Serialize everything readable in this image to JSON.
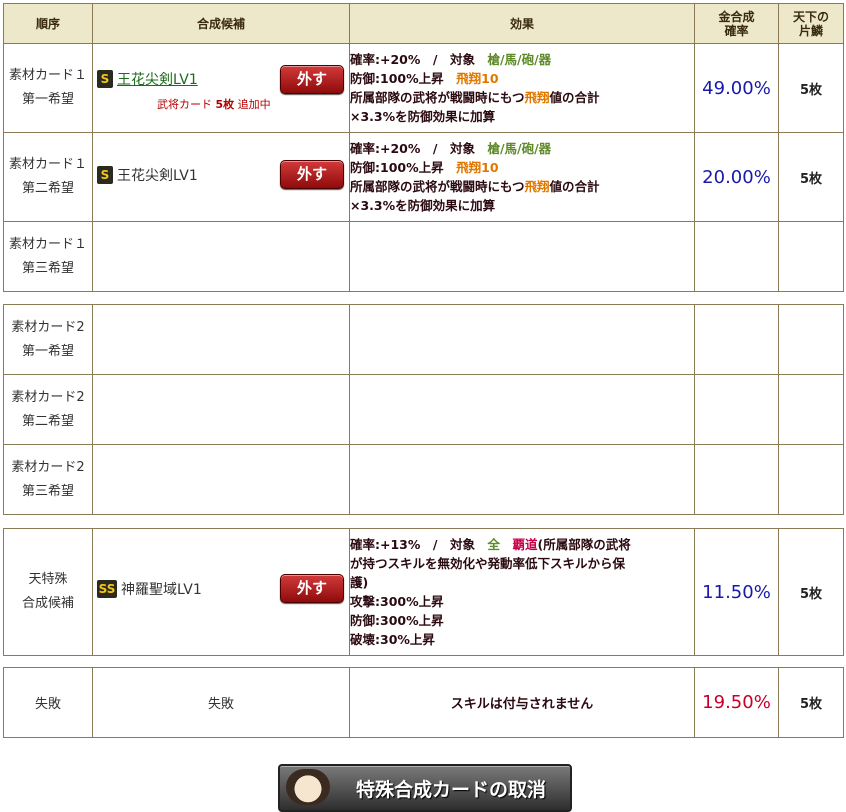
{
  "headers": {
    "order": "順序",
    "candidate": "合成候補",
    "effect": "効果",
    "gold_prob_line1": "金合成",
    "gold_prob_line2": "確率",
    "scale_line1": "天下の",
    "scale_line2": "片鱗"
  },
  "remove_label": "外す",
  "material1": [
    {
      "order_line1": "素材カード１",
      "order_line2": "第一希望",
      "rank": "S",
      "skill": "王花尖剣LV1",
      "note_prefix": "武将カード",
      "note_count": "5枚",
      "note_suffix": "追加中",
      "effect": {
        "line1_a": "確率:+20%　/　対象　",
        "line1_targets": "槍/馬/砲/器",
        "line2_a": "防御:100%上昇　",
        "line2_b": "飛翔10",
        "line3_a": "所属部隊の武将が戦闘時にもつ",
        "line3_b": "飛翔",
        "line3_c": "値の合計",
        "line4": "×3.3%を防御効果に加算"
      },
      "probability": "49.00%",
      "scale": "5枚"
    },
    {
      "order_line1": "素材カード１",
      "order_line2": "第二希望",
      "rank": "S",
      "skill": "王花尖剣LV1",
      "effect": {
        "line1_a": "確率:+20%　/　対象　",
        "line1_targets": "槍/馬/砲/器",
        "line2_a": "防御:100%上昇　",
        "line2_b": "飛翔10",
        "line3_a": "所属部隊の武将が戦闘時にもつ",
        "line3_b": "飛翔",
        "line3_c": "値の合計",
        "line4": "×3.3%を防御効果に加算"
      },
      "probability": "20.00%",
      "scale": "5枚"
    },
    {
      "order_line1": "素材カード１",
      "order_line2": "第三希望"
    }
  ],
  "material2": [
    {
      "order_line1": "素材カード2",
      "order_line2": "第一希望"
    },
    {
      "order_line1": "素材カード2",
      "order_line2": "第二希望"
    },
    {
      "order_line1": "素材カード2",
      "order_line2": "第三希望"
    }
  ],
  "special": {
    "order_line1": "天特殊",
    "order_line2": "合成候補",
    "rank": "SS",
    "skill": "神羅聖域LV1",
    "effect": {
      "line1_a": "確率:+13%　/　対象　",
      "line1_all": "全",
      "line1_haou": "覇道",
      "line1_b": "(所属部隊の武将",
      "line2": "が持つスキルを無効化や発動率低下スキルから保",
      "line3": "護)",
      "line4": "攻撃:300%上昇",
      "line5": "防御:300%上昇",
      "line6": "破壊:30%上昇"
    },
    "probability": "11.50%",
    "scale": "5枚"
  },
  "failure": {
    "order": "失敗",
    "candidate": "失敗",
    "effect": "スキルは付与されません",
    "probability": "19.50%",
    "scale": "5枚"
  },
  "cancel_button": "特殊合成カードの取消"
}
